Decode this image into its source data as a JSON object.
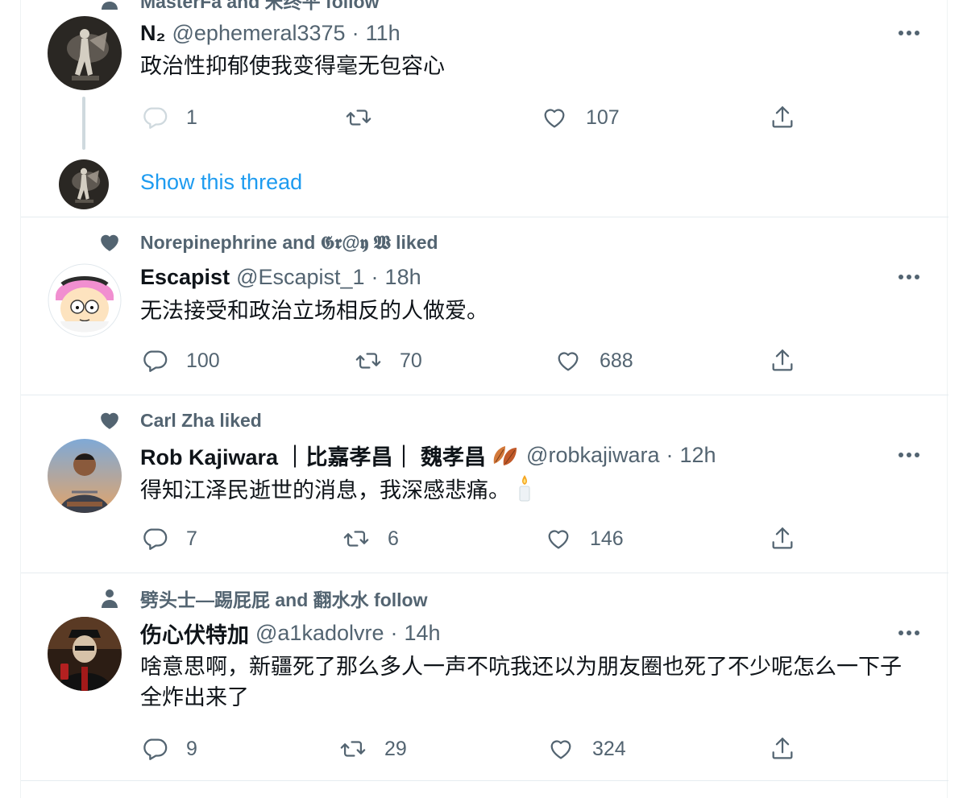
{
  "top_social": {
    "text": "MasterFa and 宋终平 follow",
    "icon": "person-icon"
  },
  "tweets": [
    {
      "name": "N₂",
      "handle": "@ephemeral3375",
      "time": "11h",
      "text": "政治性抑郁使我变得毫无包容心",
      "reply_count": "1",
      "retweet_count": "",
      "like_count": "107",
      "show_thread": "Show this thread"
    },
    {
      "social": "Norepinephrine and 𝕲𝖗@𝖞 𝖂 liked",
      "name": "Escapist",
      "handle": "@Escapist_1",
      "time": "18h",
      "text": "无法接受和政治立场相反的人做爱。",
      "reply_count": "100",
      "retweet_count": "70",
      "like_count": "688"
    },
    {
      "social": "Carl Zha liked",
      "name": "Rob Kajiwara ｜比嘉孝昌｜ 魏孝昌",
      "handle": "@robkajiwara",
      "time": "12h",
      "text": "得知江泽民逝世的消息，我深感悲痛。",
      "reply_count": "7",
      "retweet_count": "6",
      "like_count": "146"
    },
    {
      "social": "劈头士—踢屁屁 and 翻水水 follow",
      "name": "伤心伏特加",
      "handle": "@a1kadolvre",
      "time": "14h",
      "text": "啥意思啊，新疆死了那么多人一声不吭我还以为朋友圈也死了不少呢怎么一下子全炸出来了",
      "reply_count": "9",
      "retweet_count": "29",
      "like_count": "324"
    }
  ],
  "separator": "·",
  "colors": {
    "accent": "#1d9bf0",
    "secondary_text": "#536471",
    "primary_text": "#0f1419",
    "thread_line": "#cfd9de"
  }
}
